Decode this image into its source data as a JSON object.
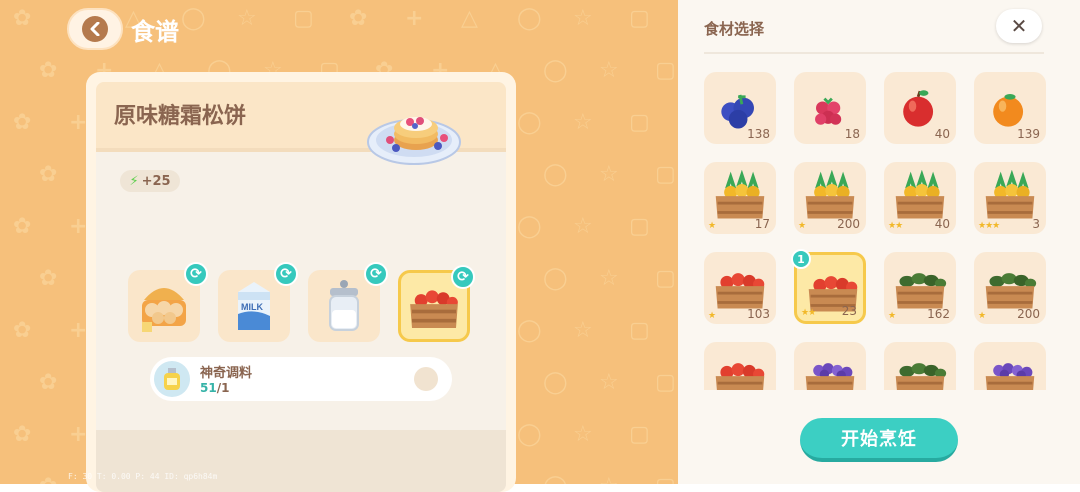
{
  "header": {
    "title": "食谱"
  },
  "recipe": {
    "name": "原味糖霜松饼",
    "energy": "+25",
    "ingredients": [
      {
        "icon": "egg-basket-icon"
      },
      {
        "icon": "milk-carton-icon"
      },
      {
        "icon": "sugar-jar-icon"
      },
      {
        "icon": "tomato-crate-icon",
        "selected": true
      }
    ],
    "seasoning": {
      "name": "神奇调料",
      "have": "51",
      "need": "/1"
    }
  },
  "debug_text": "F: 30  T: 0.00  P: 44  ID: qp6h84m",
  "panel": {
    "title": "食材选择",
    "close_label": "✕",
    "cook_label": "开始烹饪",
    "items": [
      {
        "icon": "blueberry-icon",
        "count": "138"
      },
      {
        "icon": "raspberry-icon",
        "count": "18"
      },
      {
        "icon": "apple-icon",
        "count": "40"
      },
      {
        "icon": "orange-icon",
        "count": "139"
      },
      {
        "icon": "pineapple-crate-icon",
        "count": "17",
        "stars": "★"
      },
      {
        "icon": "pineapple-crate-icon",
        "count": "200",
        "stars": "★"
      },
      {
        "icon": "pineapple-crate-icon",
        "count": "40",
        "stars": "★★"
      },
      {
        "icon": "pineapple-crate-icon",
        "count": "3",
        "stars": "★★★"
      },
      {
        "icon": "tomato-crate-icon",
        "count": "103",
        "stars": "★"
      },
      {
        "icon": "tomato-crate-icon",
        "count": "23",
        "stars": "★★",
        "selected": true,
        "badge": "1"
      },
      {
        "icon": "avocado-crate-icon",
        "count": "162",
        "stars": "★"
      },
      {
        "icon": "avocado-crate-icon",
        "count": "200",
        "stars": "★"
      },
      {
        "icon": "tomato-crate-icon",
        "count": ""
      },
      {
        "icon": "grape-crate-icon",
        "count": ""
      },
      {
        "icon": "avocado-crate-icon",
        "count": ""
      },
      {
        "icon": "grape-crate-icon",
        "count": ""
      }
    ]
  },
  "colors": {
    "accent": "#3ccfc3",
    "background": "#f6c07b",
    "text": "#8a6550"
  }
}
